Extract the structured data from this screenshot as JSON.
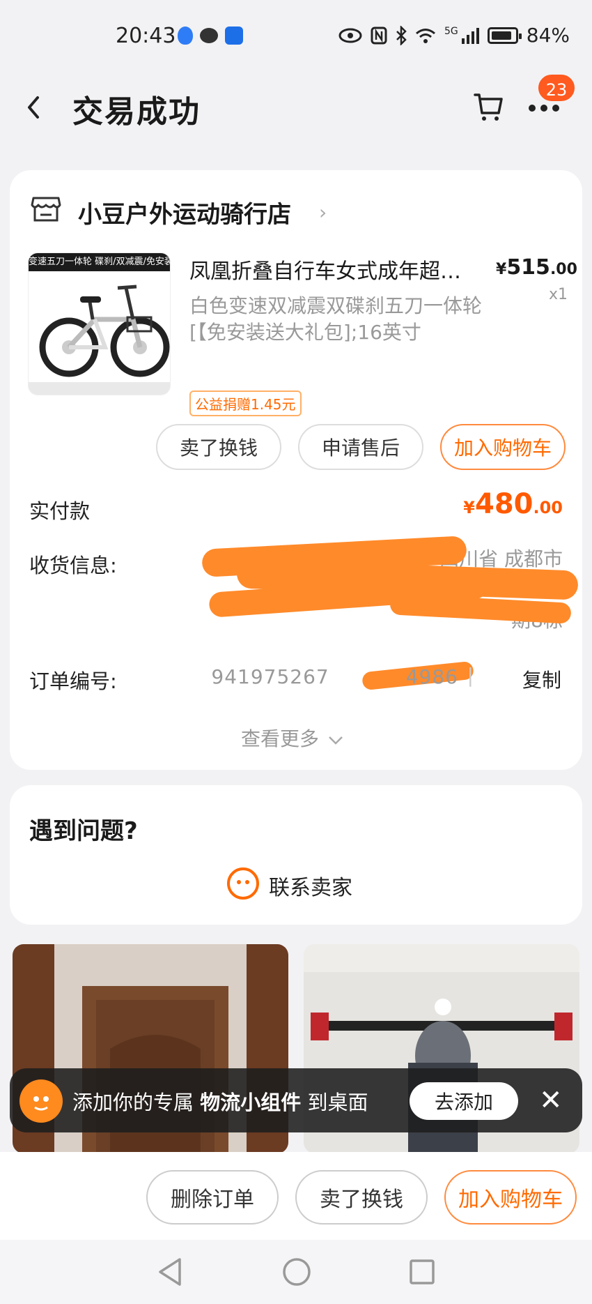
{
  "status_bar": {
    "time": "20:43",
    "network": "5G",
    "battery": "84%"
  },
  "header": {
    "title": "交易成功",
    "cart_badge": "23"
  },
  "shop": {
    "name": "小豆户外运动骑行店"
  },
  "product": {
    "title": "凤凰折叠自行车女式成年超…",
    "price_symbol": "¥",
    "price_int": "515",
    "price_dec": ".00",
    "qty": "x1",
    "spec": "白色变速双减震双碟刹五刀一体轮[【免安装送大礼包];16英寸",
    "charity": "公益捐赠1.45元",
    "image_banner": "变速五刀一体轮 碟刹/双减震/免安装"
  },
  "item_actions": {
    "sell": "卖了换钱",
    "after_sale": "申请售后",
    "add_cart": "加入购物车"
  },
  "payment": {
    "label": "实付款",
    "symbol": "¥",
    "int": "480",
    "dec": ".00"
  },
  "shipping": {
    "label": "收货信息:",
    "visible_text": "四川省 成都市",
    "tail": "期8栋"
  },
  "order": {
    "label": "订单编号:",
    "number_head": "941975267",
    "number_tail": "4986",
    "separator": "|",
    "copy": "复制"
  },
  "view_more": "查看更多",
  "problem": {
    "title": "遇到问题?",
    "contact": "联系卖家"
  },
  "widget": {
    "prefix": "添加你的专属",
    "highlight": "物流小组件",
    "suffix": "到桌面",
    "button": "去添加"
  },
  "bottom_actions": {
    "delete": "删除订单",
    "sell": "卖了换钱",
    "add_cart": "加入购物车"
  }
}
